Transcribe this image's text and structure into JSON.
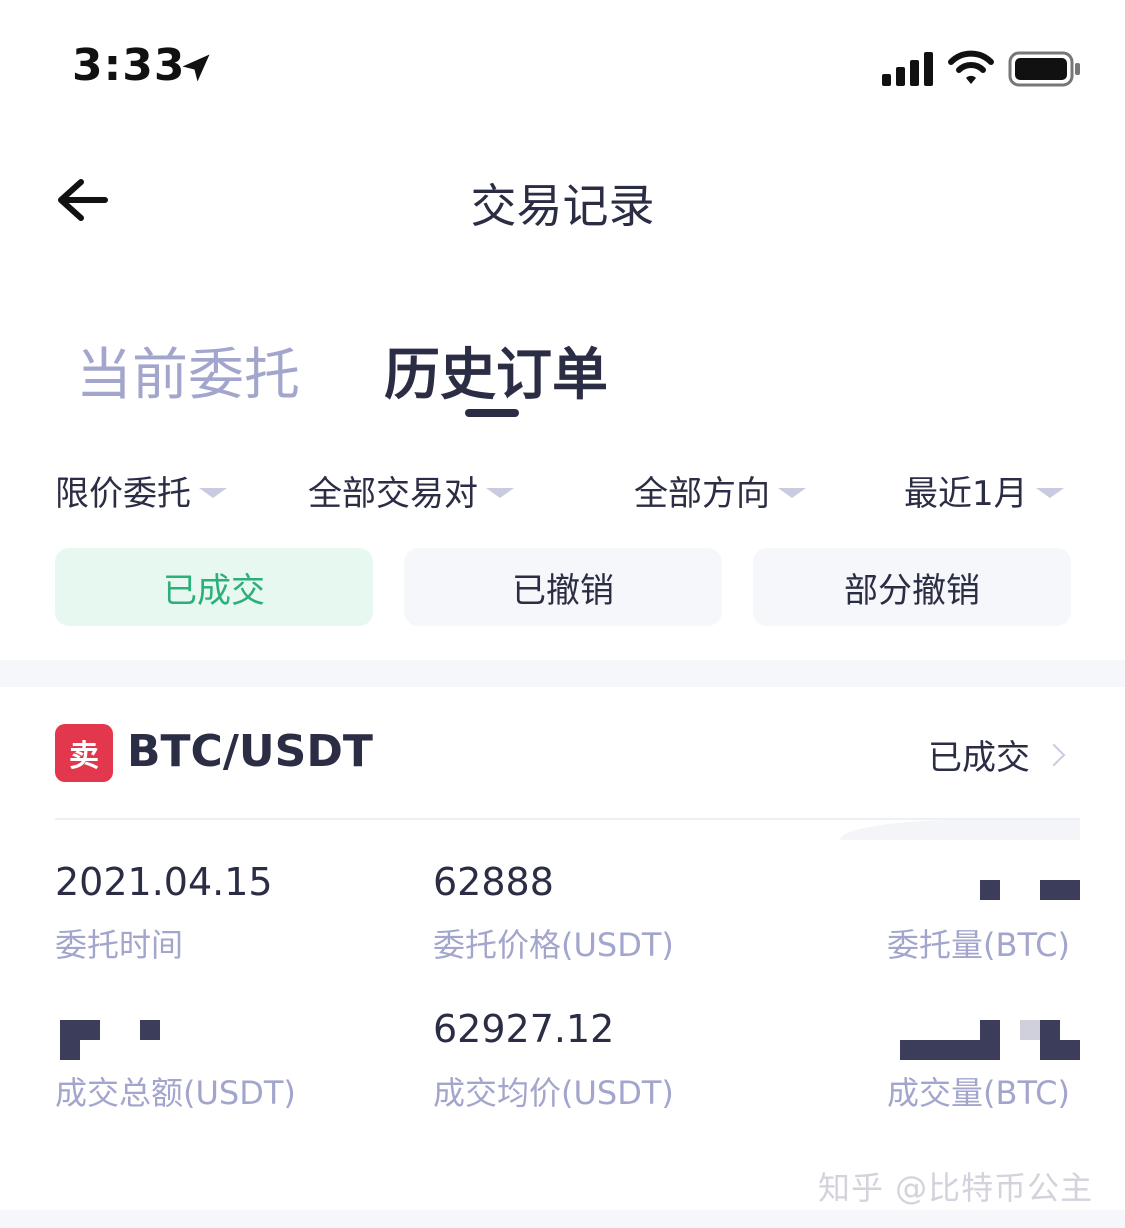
{
  "status_bar": {
    "time": "3:33"
  },
  "header": {
    "title": "交易记录"
  },
  "tabs": [
    {
      "label": "当前委托",
      "active": false
    },
    {
      "label": "历史订单",
      "active": true
    }
  ],
  "filters": [
    {
      "label": "限价委托"
    },
    {
      "label": "全部交易对"
    },
    {
      "label": "全部方向"
    },
    {
      "label": "最近1月"
    }
  ],
  "status_chips": [
    {
      "label": "已成交",
      "active": true
    },
    {
      "label": "已撤销",
      "active": false
    },
    {
      "label": "部分撤销",
      "active": false
    }
  ],
  "order": {
    "side_badge": "卖",
    "pair": "BTC/USDT",
    "status": "已成交",
    "fields": {
      "order_time": {
        "value": "2021.04.15",
        "label": "委托时间"
      },
      "order_price": {
        "value": "62888",
        "label": "委托价格(USDT)"
      },
      "order_amount": {
        "label": "委托量(BTC)"
      },
      "filled_total": {
        "label": "成交总额(USDT)"
      },
      "avg_price": {
        "value": "62927.12",
        "label": "成交均价(USDT)"
      },
      "filled_amount": {
        "label": "成交量(BTC)"
      }
    }
  },
  "watermark": "知乎 @比特币公主",
  "colors": {
    "text_primary": "#2b2d45",
    "text_secondary": "#a3a6cc",
    "accent_green": "#2bb07a",
    "sell_red": "#e2374c"
  }
}
